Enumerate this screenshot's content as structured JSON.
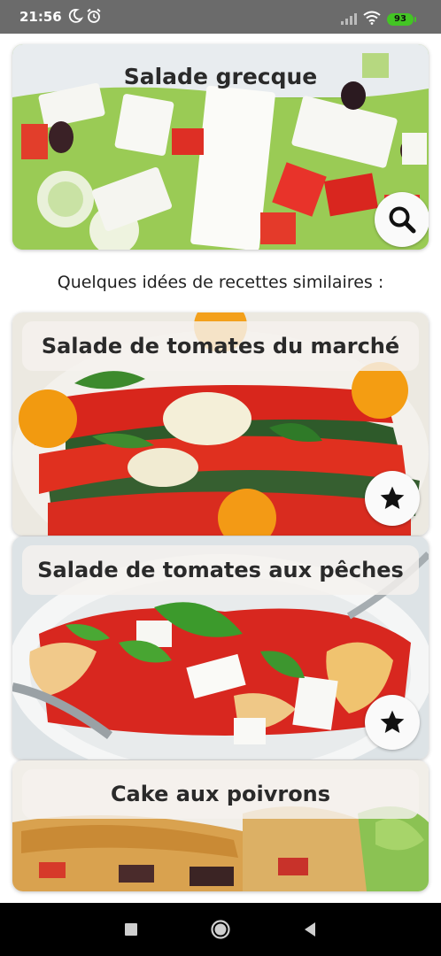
{
  "status_bar": {
    "time": "21:56",
    "battery": "93",
    "icons": [
      "moon-icon",
      "alarm-icon",
      "signal-icon",
      "wifi-icon",
      "battery-icon"
    ]
  },
  "main_recipe": {
    "title": "Salade grecque",
    "search_icon": "search-icon"
  },
  "similar_heading": "Quelques idées de recettes similaires :",
  "similar_recipes": [
    {
      "title": "Salade de tomates du marché",
      "favorite_icon": "star-icon"
    },
    {
      "title": "Salade de tomates aux pêches",
      "favorite_icon": "star-icon"
    },
    {
      "title": "Cake aux poivrons"
    }
  ],
  "colors": {
    "status_bar": "#6b6b6b",
    "battery": "#43c524",
    "nav_bar": "#000000",
    "title_pill": "#f5f2ee"
  },
  "nav_bar": {
    "icons": [
      "recent-apps-icon",
      "home-icon",
      "back-icon"
    ]
  }
}
